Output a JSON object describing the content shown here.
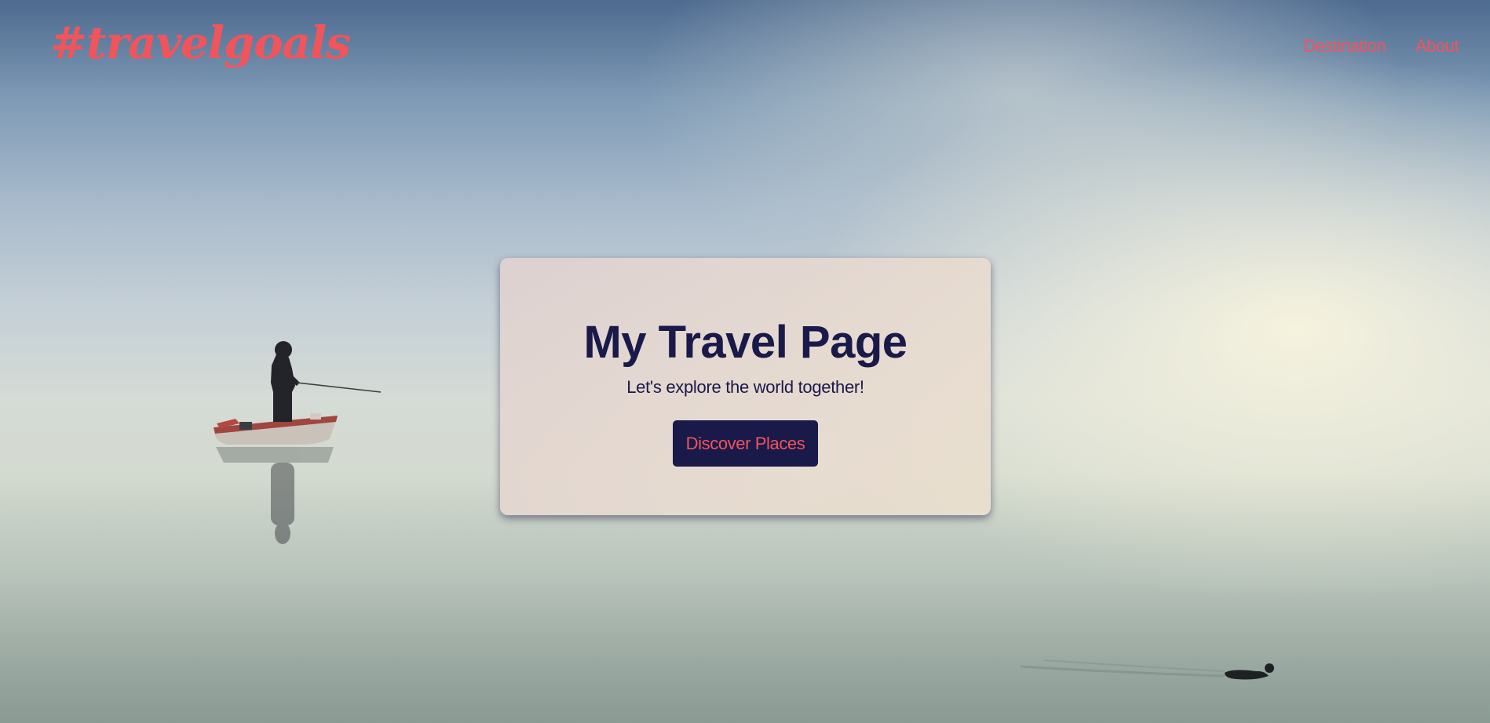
{
  "header": {
    "logo_text": "#travelgoals",
    "nav": [
      {
        "label": "Destination"
      },
      {
        "label": "About"
      }
    ]
  },
  "hero": {
    "title": "My Travel Page",
    "subtitle": "Let's explore the world together!",
    "cta_label": "Discover Places"
  },
  "colors": {
    "accent": "#f2545b",
    "navy": "#19194a",
    "card_bg": "#e3d6cf"
  }
}
